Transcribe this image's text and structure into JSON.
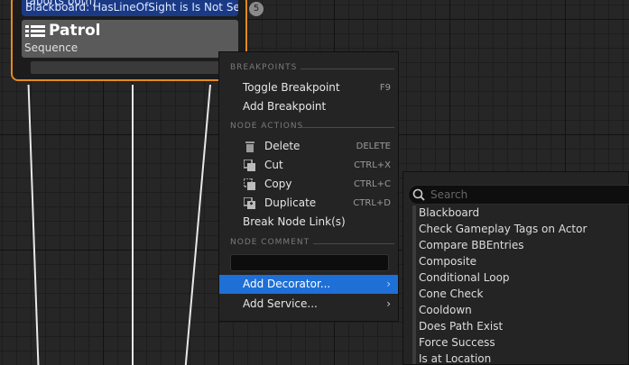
{
  "node": {
    "decorator_top": "(aborts both)",
    "decorator": "Blackboard: HasLineOfSight is Is Not Set",
    "decorator_index": "5",
    "title": "Patrol",
    "subtitle": "Sequence"
  },
  "context_menu": {
    "breakpoints_header": "BREAKPOINTS",
    "toggle_breakpoint": "Toggle Breakpoint",
    "toggle_breakpoint_shortcut": "F9",
    "add_breakpoint": "Add Breakpoint",
    "node_actions_header": "NODE ACTIONS",
    "delete": "Delete",
    "delete_shortcut": "DELETE",
    "cut": "Cut",
    "cut_shortcut": "CTRL+X",
    "copy": "Copy",
    "copy_shortcut": "CTRL+C",
    "duplicate": "Duplicate",
    "duplicate_shortcut": "CTRL+D",
    "break_links": "Break Node Link(s)",
    "node_comment_header": "NODE COMMENT",
    "comment_value": "",
    "add_decorator": "Add Decorator...",
    "add_service": "Add Service..."
  },
  "decorator_submenu": {
    "search_placeholder": "Search",
    "items": [
      "Blackboard",
      "Check Gameplay Tags on Actor",
      "Compare BBEntries",
      "Composite",
      "Conditional Loop",
      "Cone Check",
      "Cooldown",
      "Does Path Exist",
      "Force Success",
      "Is at Location"
    ]
  },
  "colors": {
    "node_border": "#e58b1e",
    "decorator_bg": "#1a3a86",
    "menu_highlight": "#1e6fd6"
  }
}
